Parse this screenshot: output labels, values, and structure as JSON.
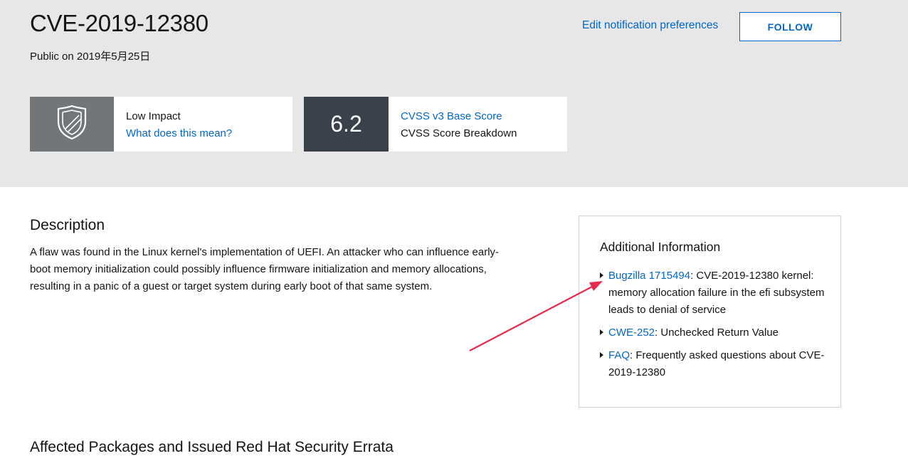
{
  "header": {
    "title": "CVE-2019-12380",
    "public_date": "Public on 2019年5月25日",
    "edit_link": "Edit notification preferences",
    "follow_label": "FOLLOW"
  },
  "impact": {
    "icon": "shield-icon",
    "label": "Low Impact",
    "link": "What does this mean?"
  },
  "cvss": {
    "score": "6.2",
    "link": "CVSS v3 Base Score",
    "breakdown": "CVSS Score Breakdown"
  },
  "description": {
    "heading": "Description",
    "text": "A flaw was found in the Linux kernel's implementation of UEFI. An attacker who can influence early-boot memory initialization could possibly influence firmware initialization and memory allocations, resulting in a panic of a guest or target system during early boot of that same system."
  },
  "additional_info": {
    "heading": "Additional Information",
    "items": [
      {
        "link": "Bugzilla 1715494",
        "text": ": CVE-2019-12380 kernel: memory allocation failure in the efi subsystem leads to denial of service"
      },
      {
        "link": "CWE-252",
        "text": ": Unchecked Return Value"
      },
      {
        "link": "FAQ",
        "text": ": Frequently asked questions about CVE-2019-12380"
      }
    ]
  },
  "affected": {
    "heading": "Affected Packages and Issued Red Hat Security Errata"
  },
  "colors": {
    "hero_bg": "#e7e7e7",
    "link": "#0066cc",
    "impact_icon_bg": "#737679",
    "score_bg": "#39424b",
    "annotation_arrow": "#e8294e"
  }
}
